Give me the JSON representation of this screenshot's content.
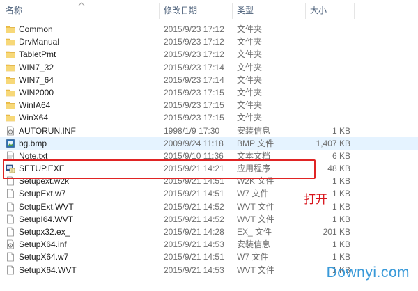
{
  "columns": {
    "name": "名称",
    "modified": "修改日期",
    "type": "类型",
    "size": "大小"
  },
  "files": [
    {
      "name": "Common",
      "date": "2015/9/23 17:12",
      "type": "文件夹",
      "size": "",
      "icon": "folder-icon"
    },
    {
      "name": "DrvManual",
      "date": "2015/9/23 17:12",
      "type": "文件夹",
      "size": "",
      "icon": "folder-icon"
    },
    {
      "name": "TabletPmt",
      "date": "2015/9/23 17:12",
      "type": "文件夹",
      "size": "",
      "icon": "folder-icon"
    },
    {
      "name": "WIN7_32",
      "date": "2015/9/23 17:14",
      "type": "文件夹",
      "size": "",
      "icon": "folder-icon"
    },
    {
      "name": "WIN7_64",
      "date": "2015/9/23 17:14",
      "type": "文件夹",
      "size": "",
      "icon": "folder-icon"
    },
    {
      "name": "WIN2000",
      "date": "2015/9/23 17:15",
      "type": "文件夹",
      "size": "",
      "icon": "folder-icon"
    },
    {
      "name": "WinIA64",
      "date": "2015/9/23 17:15",
      "type": "文件夹",
      "size": "",
      "icon": "folder-icon"
    },
    {
      "name": "WinX64",
      "date": "2015/9/23 17:15",
      "type": "文件夹",
      "size": "",
      "icon": "folder-icon"
    },
    {
      "name": "AUTORUN.INF",
      "date": "1998/1/9 17:30",
      "type": "安装信息",
      "size": "1 KB",
      "icon": "setup-info-icon"
    },
    {
      "name": "bg.bmp",
      "date": "2009/9/24 11:18",
      "type": "BMP 文件",
      "size": "1,407 KB",
      "icon": "image-file-icon",
      "highlight": true
    },
    {
      "name": "Note.txt",
      "date": "2015/9/10 11:36",
      "type": "文本文档",
      "size": "6 KB",
      "icon": "text-file-icon"
    },
    {
      "name": "SETUP.EXE",
      "date": "2015/9/21 14:21",
      "type": "应用程序",
      "size": "48 KB",
      "icon": "setup-exe-icon"
    },
    {
      "name": "Setupext.w2k",
      "date": "2015/9/21 14:51",
      "type": "W2K 文件",
      "size": "1 KB",
      "icon": "file-icon"
    },
    {
      "name": "SetupExt.w7",
      "date": "2015/9/21 14:51",
      "type": "W7 文件",
      "size": "1 KB",
      "icon": "file-icon"
    },
    {
      "name": "SetupExt.WVT",
      "date": "2015/9/21 14:52",
      "type": "WVT 文件",
      "size": "1 KB",
      "icon": "file-icon"
    },
    {
      "name": "SetupI64.WVT",
      "date": "2015/9/21 14:52",
      "type": "WVT 文件",
      "size": "1 KB",
      "icon": "file-icon"
    },
    {
      "name": "Setupx32.ex_",
      "date": "2015/9/21 14:28",
      "type": "EX_ 文件",
      "size": "201 KB",
      "icon": "file-icon"
    },
    {
      "name": "SetupX64.inf",
      "date": "2015/9/21 14:53",
      "type": "安装信息",
      "size": "1 KB",
      "icon": "setup-info-icon"
    },
    {
      "name": "SetupX64.w7",
      "date": "2015/9/21 14:51",
      "type": "W7 文件",
      "size": "1 KB",
      "icon": "file-icon"
    },
    {
      "name": "SetupX64.WVT",
      "date": "2015/9/21 14:53",
      "type": "WVT 文件",
      "size": "1 KB",
      "icon": "file-icon"
    }
  ],
  "annotation": "打开",
  "watermark": "Downyi.com",
  "colors": {
    "folder": "#f0c24b",
    "highlight_row": "#e5f3ff",
    "callout": "#e02424",
    "watermark": "#3a9ad9"
  }
}
